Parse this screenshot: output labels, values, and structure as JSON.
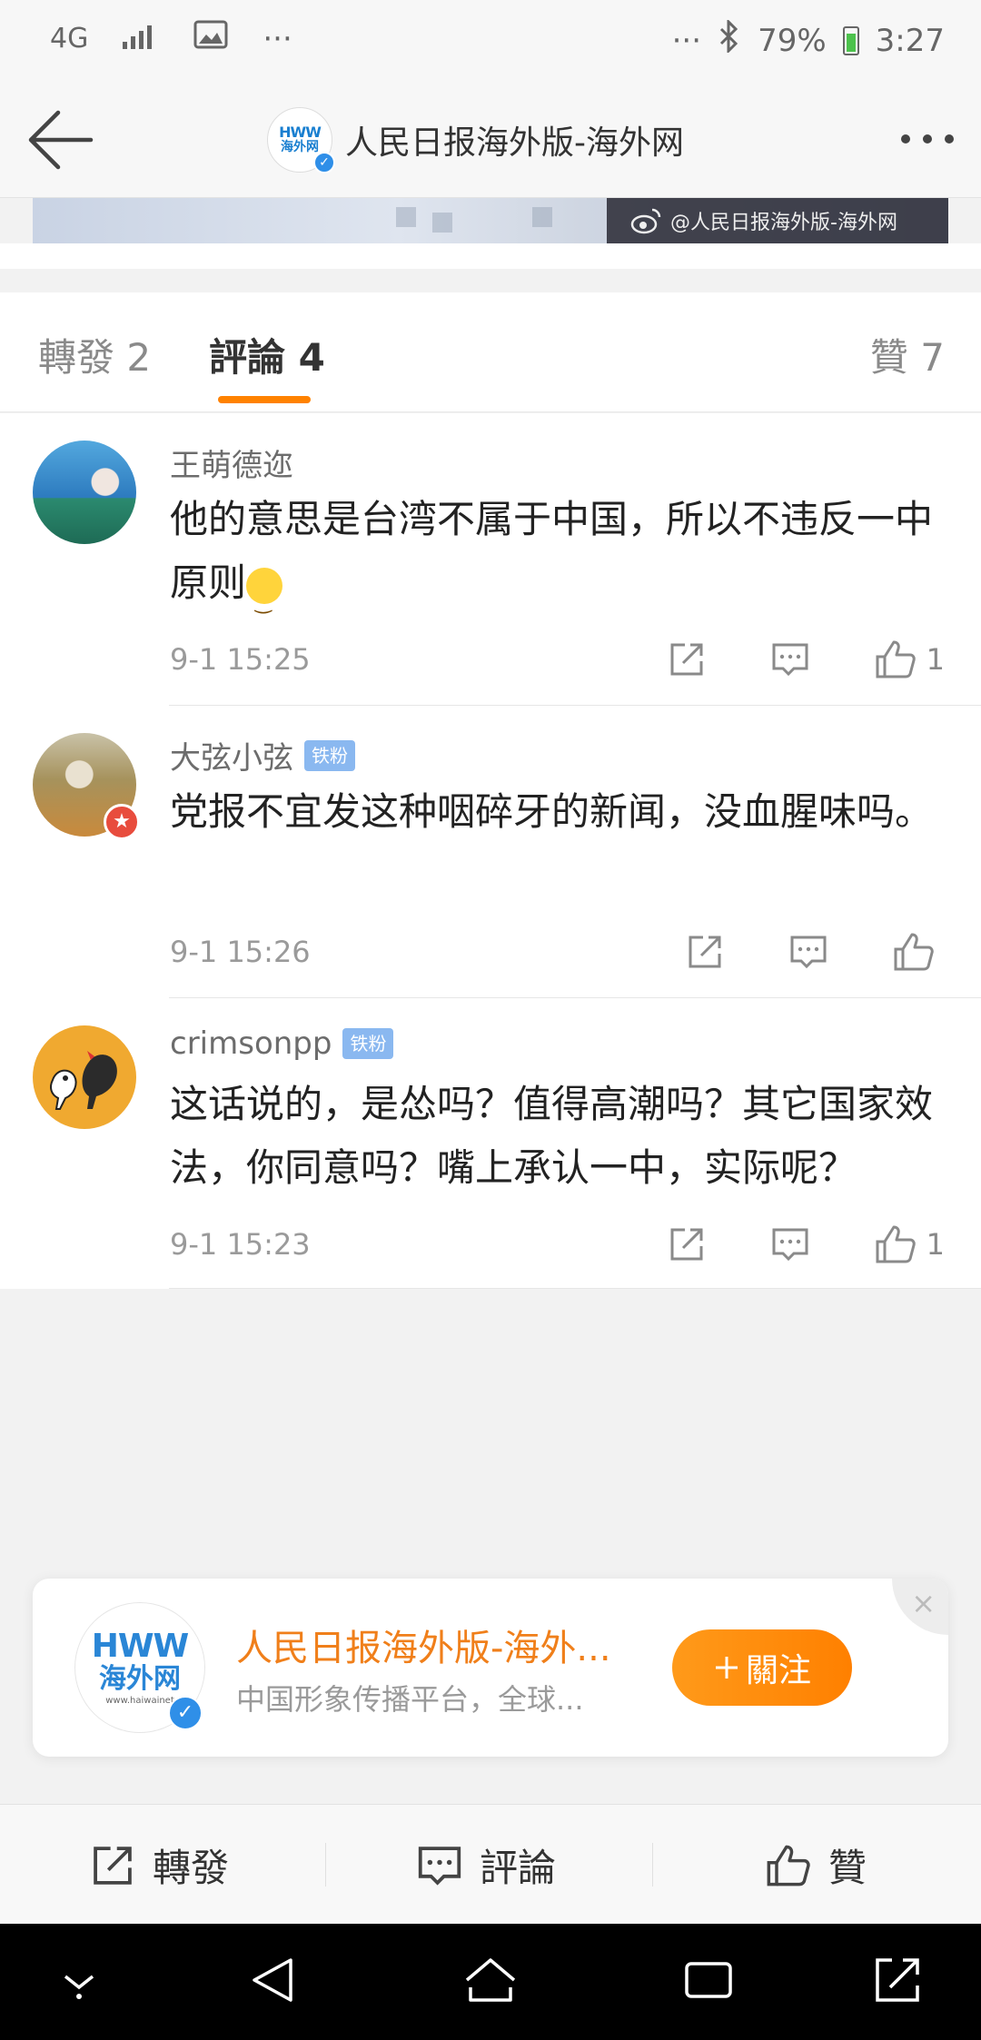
{
  "status_bar": {
    "network": "4G",
    "signal_label": "signal",
    "left_more": "···",
    "right_more": "···",
    "battery": "79%",
    "time": "3:27"
  },
  "header": {
    "title": "人民日报海外版-海外网",
    "logo_text": "HWW",
    "logo_cn": "海外网"
  },
  "image_strip": {
    "watermark": "@人民日报海外版-海外网"
  },
  "tabs": [
    {
      "label": "轉發 2"
    },
    {
      "label": "評論 4"
    },
    {
      "label": "贊 7"
    }
  ],
  "comments": [
    {
      "user": "王萌德迩",
      "badge": "",
      "text": "他的意思是台湾不属于中国，所以不违反一中原则",
      "time": "9-1 15:25",
      "likes": "1"
    },
    {
      "user": "大弦小弦",
      "badge": "铁粉",
      "text": "党报不宜发这种咽碎牙的新闻，没血腥味吗。",
      "time": "9-1 15:26",
      "likes": ""
    },
    {
      "user": "crimsonpp",
      "badge": "铁粉",
      "text": "这话说的，是怂吗？值得高潮吗？其它国家效法，你同意吗？嘴上承认一中，实际呢？",
      "time": "9-1 15:23",
      "likes": "1"
    }
  ],
  "follow_card": {
    "name": "人民日报海外版-海外...",
    "desc": "中国形象传播平台，全球...",
    "follow_label": "關注",
    "logo_text": "HWW",
    "logo_cn": "海外网",
    "logo_url": "www.haiwainet",
    "close": "×"
  },
  "bottom_bar": {
    "repost": "轉發",
    "comment": "評論",
    "like": "贊"
  },
  "colors": {
    "accent": "#ff8200",
    "badge_blue": "#8ab8f0",
    "verify_blue": "#2f8fe8"
  }
}
